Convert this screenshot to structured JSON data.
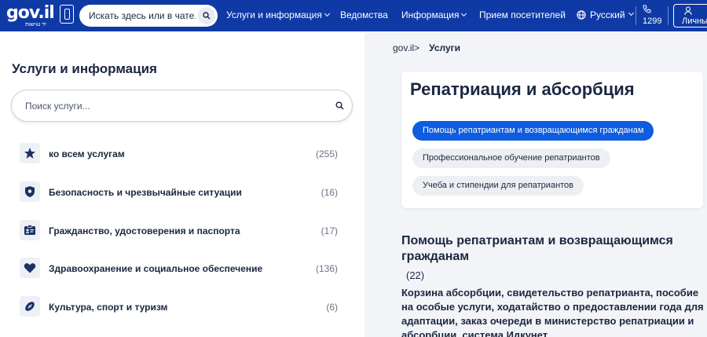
{
  "header": {
    "logo_text": "gov.il",
    "logo_sub": "יד נגישות",
    "search_placeholder": "Искать здесь или в чате...",
    "nav": [
      {
        "label": "Услуги и информация",
        "has_dropdown": true
      },
      {
        "label": "Ведомства",
        "has_dropdown": false
      },
      {
        "label": "Информация",
        "has_dropdown": true
      },
      {
        "label": "Прием посетителей",
        "has_dropdown": false
      }
    ],
    "language": "Русский",
    "phone": "1299",
    "account_label": "Личны"
  },
  "left": {
    "title": "Услуги и информация",
    "search_placeholder": "Поиск услуги...",
    "categories": [
      {
        "label": "ко всем услугам",
        "count": "(255)",
        "icon": "star-icon"
      },
      {
        "label": "Безопасность и чрезвычайные ситуации",
        "count": "(16)",
        "icon": "shield-icon"
      },
      {
        "label": "Гражданство, удостоверения и паспорта",
        "count": "(17)",
        "icon": "id-card-icon"
      },
      {
        "label": "Здравоохранение и социальное обеспечение",
        "count": "(136)",
        "icon": "heart-icon"
      },
      {
        "label": "Культура, спорт и туризм",
        "count": "(6)",
        "icon": "football-icon"
      }
    ]
  },
  "breadcrumb": {
    "root": "gov.il>",
    "current": "Услуги"
  },
  "card": {
    "title": "Репатриация и абсорбция",
    "chips": [
      {
        "label": "Помощь репатриантам и возвращающимся гражданам",
        "active": true
      },
      {
        "label": "Профессиональное обучение репатриантов",
        "active": false
      },
      {
        "label": "Учеба и стипендии для репатриантов",
        "active": false
      }
    ]
  },
  "section": {
    "title": "Помощь репатриантам и возвращающимся гражданам",
    "count": "(22)",
    "description": "Корзина абсорбции, свидетельство репатрианта, пособие на особые услуги, ходатайство о предоставлении года для адаптации, заказ очереди в министерство репатриации и абсорбции, система Идкунет"
  },
  "colors": {
    "header_bg": "#0f3aa6",
    "active_chip": "#0e5de0",
    "text": "#1b2740"
  }
}
